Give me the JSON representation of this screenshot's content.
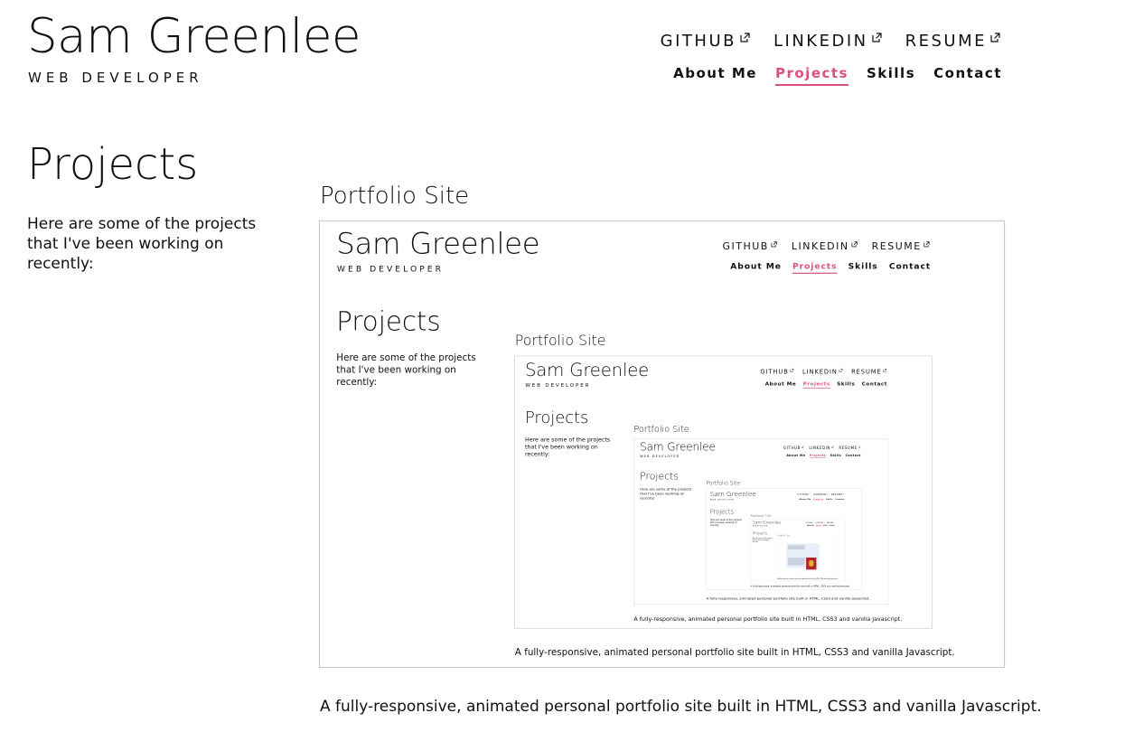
{
  "header": {
    "name": "Sam Greenlee",
    "tagline": "WEB DEVELOPER"
  },
  "external_links": [
    {
      "label": "GITHUB",
      "icon": "external-link-icon"
    },
    {
      "label": "LINKEDIN",
      "icon": "external-link-icon"
    },
    {
      "label": "RESUME",
      "icon": "external-link-icon"
    }
  ],
  "nav": {
    "items": [
      {
        "label": "About Me",
        "active": false
      },
      {
        "label": "Projects",
        "active": true
      },
      {
        "label": "Skills",
        "active": false
      },
      {
        "label": "Contact",
        "active": false
      }
    ]
  },
  "section": {
    "title": "Projects",
    "intro": "Here are some of the projects that I've been working on recently:"
  },
  "project": {
    "title": "Portfolio Site",
    "description": "A fully-responsive, animated personal portfolio site built in HTML, CSS3 and vanilla Javascript."
  },
  "colors": {
    "accent": "#d9527e",
    "text": "#111111",
    "frame_border": "#c9c9c9"
  }
}
